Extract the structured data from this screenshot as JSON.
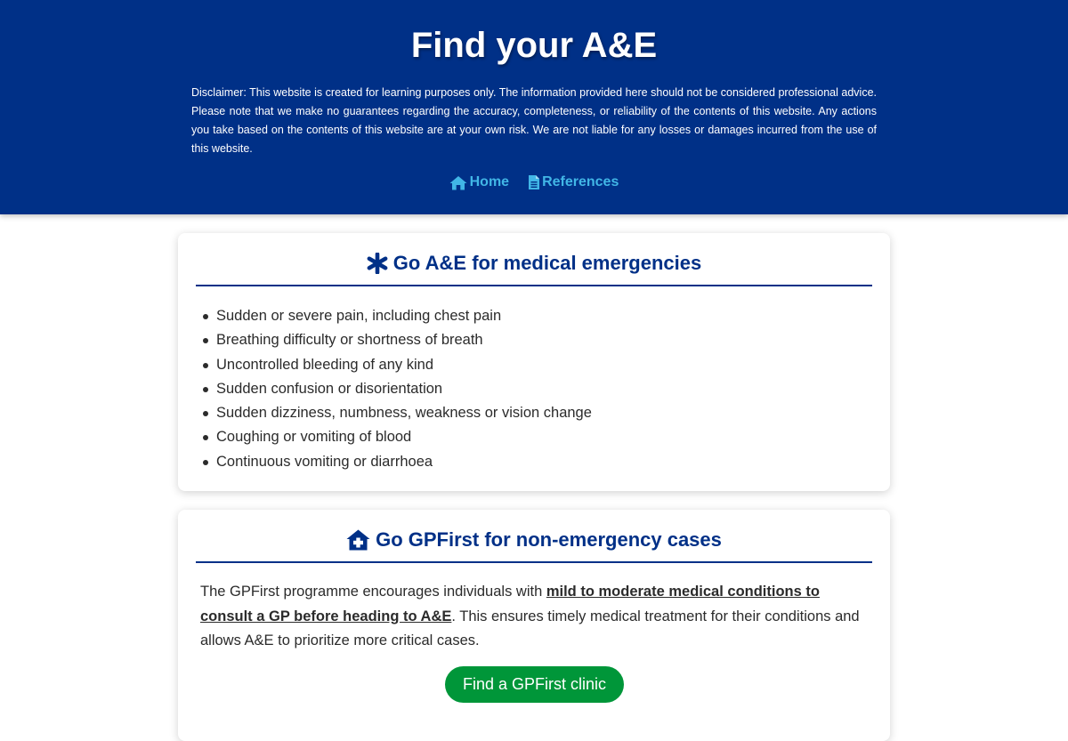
{
  "header": {
    "title": "Find your A&E",
    "disclaimer": "Disclaimer: This website is created for learning purposes only. The information provided here should not be considered professional advice. Please note that we make no guarantees regarding the accuracy, completeness, or reliability of the contents of this website. Any actions you take based on the contents of this website are at your own risk. We are not liable for any losses or damages incurred from the use of this website.",
    "nav": [
      {
        "label": "Home",
        "icon": "home-icon"
      },
      {
        "label": "References",
        "icon": "document-icon"
      }
    ]
  },
  "emergency_card": {
    "title": "Go A&E for medical emergencies",
    "icon": "asterisk-icon",
    "items": [
      "Sudden or severe pain, including chest pain",
      "Breathing difficulty or shortness of breath",
      "Uncontrolled bleeding of any kind",
      "Sudden confusion or disorientation",
      "Sudden dizziness, numbness, weakness or vision change",
      "Coughing or vomiting of blood",
      "Continuous vomiting or diarrhoea"
    ]
  },
  "gpfirst_card": {
    "title": "Go GPFirst for non-emergency cases",
    "icon": "house-medical-icon",
    "text_before": "The GPFirst programme encourages individuals with ",
    "text_link": "mild to moderate medical conditions to consult a GP before heading to A&E",
    "text_after": ". This ensures timely medical treatment for their conditions and allows A&E to prioritize more critical cases.",
    "button_label": "Find a GPFirst clinic"
  },
  "colors": {
    "header_bg": "#003087",
    "nav_link": "#41b6e6",
    "title_blue": "#003087",
    "button_green": "#009639"
  }
}
